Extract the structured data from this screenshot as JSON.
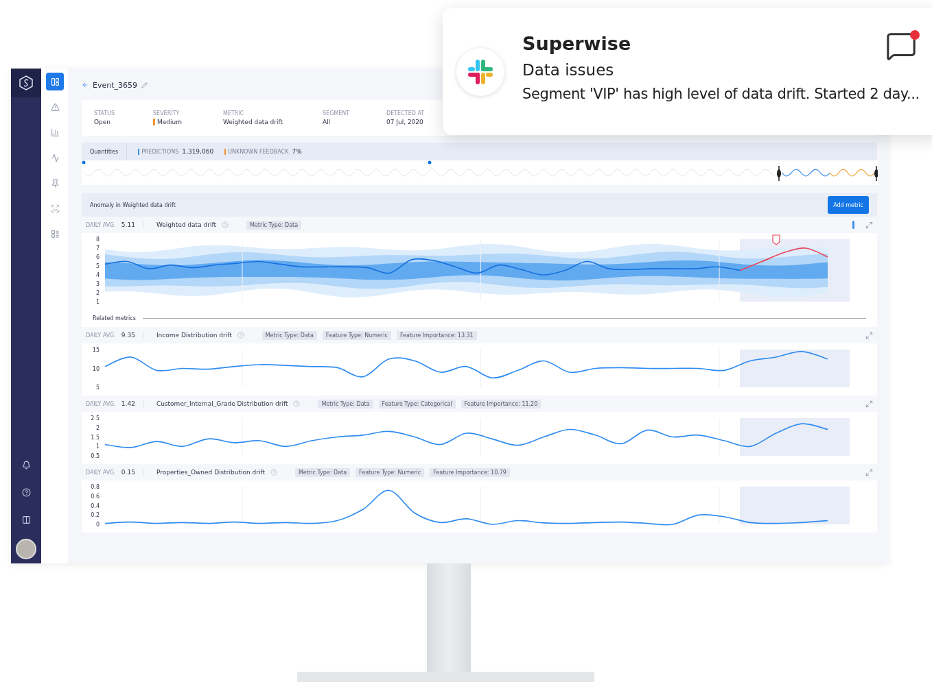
{
  "notification": {
    "app": "Superwise",
    "title": "Data issues",
    "message": "Segment 'VIP' has high level of data drift. Started 2 day...",
    "unread": true
  },
  "nav": {
    "items": [
      {
        "selected": true
      },
      {
        "selected": false
      },
      {
        "selected": false
      },
      {
        "selected": false
      },
      {
        "selected": false
      },
      {
        "selected": false
      },
      {
        "selected": false
      }
    ]
  },
  "event": {
    "title": "Event_3659",
    "fields": [
      {
        "label": "STATUS",
        "value": "Open"
      },
      {
        "label": "SEVERITY",
        "value": "Medium",
        "color": "#f5922f"
      },
      {
        "label": "METRIC",
        "value": "Weighted data drift"
      },
      {
        "label": "SEGMENT",
        "value": "All"
      },
      {
        "label": "DETECTED AT",
        "value": "07 Jul, 2020"
      }
    ]
  },
  "quantities": {
    "label": "Quantities",
    "stats": [
      {
        "label": "PREDICTIONS",
        "value": "1,319,060",
        "color": "#3d8ef0"
      },
      {
        "label": "UNKNOWN FEEDBACK",
        "value": "7%",
        "color": "#f5922f"
      }
    ]
  },
  "anomaly": {
    "title": "Anomaly in Weighted data drift",
    "button": "Add metric",
    "metric": {
      "avg_label": "DAILY AVG.",
      "avg": "5.11",
      "name": "Weighted data drift",
      "tags": [
        "Metric Type: Data"
      ],
      "chart_data": {
        "type": "line",
        "ylim": [
          1,
          8
        ],
        "yticks": [
          1,
          2,
          3,
          4,
          5,
          6,
          7,
          8
        ],
        "series": [
          {
            "color": "#1672e0",
            "values": [
              5.2,
              5.5,
              4.7,
              5.1,
              4.8,
              5.1,
              5.3,
              5.5,
              5.2,
              4.9,
              4.9,
              4.9,
              4.8,
              4.2,
              5.7,
              5.6,
              4.9,
              4.2,
              5.1,
              4.6,
              4.0,
              4.5,
              5.5,
              4.7,
              4.6,
              4.7,
              4.7,
              4.7,
              4.9,
              4.5,
              null,
              null,
              null,
              null
            ]
          },
          {
            "color": "#e8475a",
            "values": [
              null,
              null,
              null,
              null,
              null,
              null,
              null,
              null,
              null,
              null,
              null,
              null,
              null,
              null,
              null,
              null,
              null,
              null,
              null,
              null,
              null,
              null,
              null,
              null,
              null,
              null,
              null,
              null,
              null,
              4.5,
              5.5,
              6.5,
              7.0,
              6.0
            ]
          }
        ]
      }
    }
  },
  "related": {
    "title": "Related metrics",
    "metrics": [
      {
        "avg_label": "DAILY AVG.",
        "avg": "9.35",
        "name": "Income Distribution drift",
        "tags": [
          "Metric Type: Data",
          "Feature Type: Numeric",
          "Feature Importance: 13.31"
        ],
        "chart_data": {
          "type": "line",
          "ylim": [
            5,
            15
          ],
          "yticks": [
            5,
            10,
            15
          ],
          "series": [
            {
              "color": "#2f8cf0",
              "values": [
                10.5,
                13,
                9.5,
                10,
                9.8,
                10.5,
                11,
                10.8,
                10.5,
                10.2,
                7.8,
                12.5,
                12,
                9,
                10.5,
                7.5,
                9.5,
                12,
                9,
                10,
                10.2,
                10,
                10,
                10,
                9.5,
                12,
                13,
                14.5,
                12.5
              ]
            }
          ]
        }
      },
      {
        "avg_label": "DAILY AVG.",
        "avg": "1.42",
        "name": "Customer_Internal_Grade Distribution drift",
        "tags": [
          "Metric Type: Data",
          "Feature Type: Categorical",
          "Feature Importance: 11.20"
        ],
        "chart_data": {
          "type": "line",
          "ylim": [
            0.5,
            2.5
          ],
          "yticks": [
            0.5,
            1,
            1.5,
            2,
            2.5
          ],
          "series": [
            {
              "color": "#2f8cf0",
              "values": [
                1.1,
                0.94,
                1.26,
                1.0,
                1.4,
                1.2,
                1.3,
                1.0,
                1.3,
                1.5,
                1.6,
                1.8,
                1.5,
                1.1,
                1.7,
                1.4,
                1.06,
                1.5,
                1.9,
                1.6,
                1.14,
                1.86,
                1.5,
                1.6,
                1.3,
                1.0,
                1.7,
                2.2,
                1.9
              ]
            }
          ]
        }
      },
      {
        "avg_label": "DAILY AVG.",
        "avg": "0.15",
        "name": "Properties_Owned Distribution drift",
        "tags": [
          "Metric Type: Data",
          "Feature Type: Numeric",
          "Feature Importance: 10.79"
        ],
        "chart_data": {
          "type": "line",
          "ylim": [
            0,
            0.8
          ],
          "yticks": [
            0,
            0.2,
            0.4,
            0.6,
            0.8
          ],
          "series": [
            {
              "color": "#2f8cf0",
              "values": [
                0.02,
                0.05,
                0.02,
                0.04,
                0.02,
                0.05,
                0.02,
                0.04,
                0.02,
                0.08,
                0.32,
                0.72,
                0.24,
                0.04,
                0.12,
                0,
                0.08,
                0.03,
                0.02,
                0.04,
                0.05,
                0.02,
                0,
                0.2,
                0.16,
                0.04,
                0.02,
                0.04,
                0.08
              ]
            }
          ]
        }
      }
    ]
  }
}
